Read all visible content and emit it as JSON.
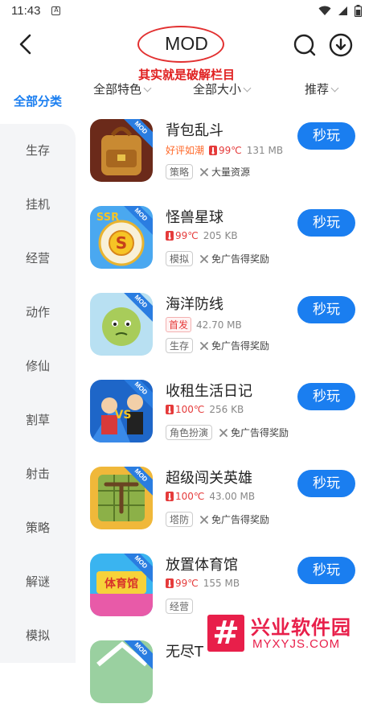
{
  "status_bar": {
    "time": "11:43",
    "notification_icon": "A"
  },
  "header": {
    "title": "MOD"
  },
  "annotation": "其实就是破解栏目",
  "sidebar": {
    "active": "全部分类",
    "items": [
      "生存",
      "挂机",
      "经营",
      "动作",
      "修仙",
      "割草",
      "射击",
      "策略",
      "解谜",
      "模拟"
    ]
  },
  "filters": [
    "全部特色",
    "全部大小",
    "推荐"
  ],
  "games": [
    {
      "name": "背包乱斗",
      "badge": "好评如潮",
      "heat": "99℃",
      "size": "131 MB",
      "tag": "策略",
      "feature": "大量资源",
      "play": "秒玩",
      "mod": "MOD"
    },
    {
      "name": "怪兽星球",
      "badge": "",
      "heat": "99℃",
      "size": "205 KB",
      "tag": "模拟",
      "feature": "免广告得奖励",
      "play": "秒玩",
      "mod": "MOD"
    },
    {
      "name": "海洋防线",
      "badge": "首发",
      "heat": "",
      "size": "42.70 MB",
      "tag": "生存",
      "feature": "免广告得奖励",
      "play": "秒玩",
      "mod": "MOD"
    },
    {
      "name": "收租生活日记",
      "badge": "",
      "heat": "100℃",
      "size": "256 KB",
      "tag": "角色扮演",
      "feature": "免广告得奖励",
      "play": "秒玩",
      "mod": "MOD"
    },
    {
      "name": "超级闯关英雄",
      "badge": "",
      "heat": "100℃",
      "size": "43.00 MB",
      "tag": "塔防",
      "feature": "免广告得奖励",
      "play": "秒玩",
      "mod": "MOD"
    },
    {
      "name": "放置体育馆",
      "badge": "",
      "heat": "99℃",
      "size": "155 MB",
      "tag": "经营",
      "feature": "",
      "play": "秒玩",
      "mod": "MOD"
    },
    {
      "name": "无尽T",
      "badge": "",
      "heat": "",
      "size": "",
      "tag": "",
      "feature": "",
      "play": "",
      "mod": "MOD"
    }
  ],
  "icon_art": {
    "ssr": "SSR",
    "s": "S",
    "vs": "VS",
    "sports": "体育馆"
  },
  "watermark": {
    "brand": "兴业软件园",
    "url": "MYXYJS.COM"
  },
  "colors": {
    "accent": "#1a7ef0",
    "annotation": "#e02020",
    "heat": "#e53b3b",
    "watermark": "#e81f4a"
  }
}
